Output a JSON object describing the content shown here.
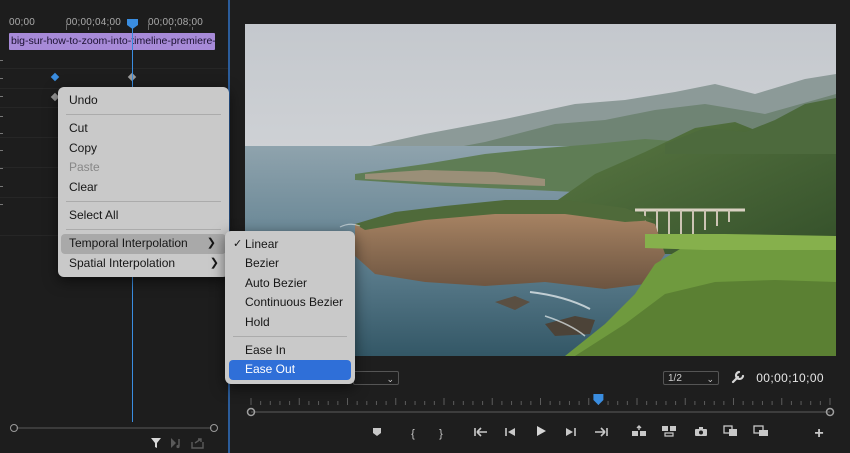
{
  "timeline": {
    "timecodes": [
      "00;00",
      "00;00;04;00",
      "00;00;08;00"
    ],
    "clip_name": "big-sur-how-to-zoom-into-timeline-premiere-p"
  },
  "context_menu": {
    "items": [
      {
        "label": "Undo",
        "enabled": true
      },
      {
        "label": "Cut",
        "enabled": true
      },
      {
        "label": "Copy",
        "enabled": true
      },
      {
        "label": "Paste",
        "enabled": false
      },
      {
        "label": "Clear",
        "enabled": true
      },
      {
        "label": "Select All",
        "enabled": true
      },
      {
        "label": "Temporal Interpolation",
        "has_submenu": true,
        "highlighted": true
      },
      {
        "label": "Spatial Interpolation",
        "has_submenu": true
      }
    ]
  },
  "submenu": {
    "items": [
      {
        "label": "Linear",
        "checked": true
      },
      {
        "label": "Bezier"
      },
      {
        "label": "Auto Bezier"
      },
      {
        "label": "Continuous Bezier"
      },
      {
        "label": "Hold"
      },
      {
        "label": "Ease In"
      },
      {
        "label": "Ease Out",
        "selected": true
      }
    ],
    "check_glyph": "✓"
  },
  "monitor": {
    "resolution": "1/2",
    "timecode": "00;00;10;00",
    "playhead_fraction": 0.6
  },
  "colors": {
    "accent_blue": "#2f6fd8",
    "clip_purple": "#a78ad8",
    "playhead": "#3a8de0"
  },
  "icons": {
    "left_panel": [
      "filter-icon",
      "play-audio-icon",
      "export-icon"
    ],
    "monitor_bar": [
      "wrench-icon"
    ],
    "transport": [
      "add-marker-icon",
      "mark-in-icon",
      "mark-out-icon",
      "go-to-in-icon",
      "step-back-icon",
      "play-icon",
      "step-forward-icon",
      "go-to-out-icon",
      "lift-icon",
      "extract-icon",
      "camera-icon",
      "comparison-view-icon",
      "proxy-toggle-icon",
      "add-button-icon"
    ]
  }
}
